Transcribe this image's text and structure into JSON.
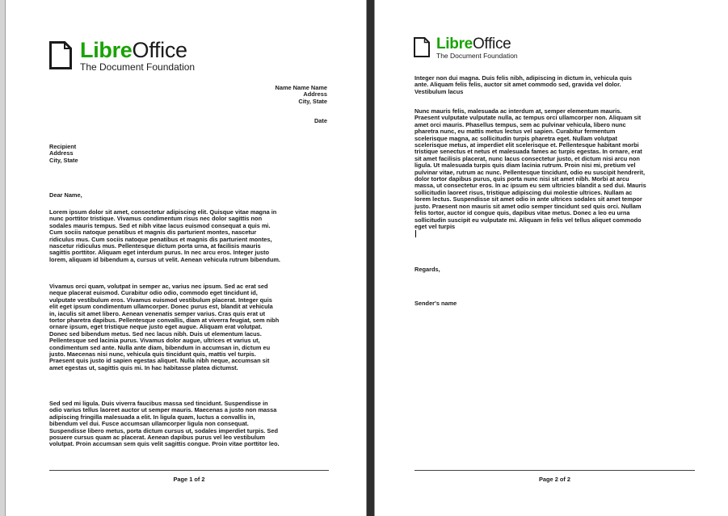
{
  "logo": {
    "libre": "Libre",
    "office": "Office",
    "tagline": "The Document Foundation"
  },
  "page1": {
    "sender": [
      "Name Name Name",
      "Address",
      "City, State"
    ],
    "date_label": "Date",
    "recipient": [
      "Recipient",
      "Address",
      "City, State"
    ],
    "greeting": "Dear Name,",
    "paragraph1": [
      "Lorem ipsum dolor sit amet, consectetur adipiscing elit. Quisque vitae magna in",
      "nunc porttitor tristique. Vivamus condimentum risus nec dolor sagittis non",
      "sodales mauris tempus. Sed et nibh vitae lacus euismod consequat a quis mi.",
      "Cum sociis natoque penatibus et magnis dis parturient montes, nascetur",
      "ridiculus mus. Cum sociis natoque penatibus et magnis dis parturient montes,",
      "nascetur ridiculus mus. Pellentesque dictum porta urna, at facilisis mauris",
      "sagittis porttitor. Aliquam eget interdum purus. In nec arcu eros. Integer justo",
      "lorem, aliquam id bibendum a, cursus ut velit. Aenean vehicula rutrum bibendum."
    ],
    "paragraph2": [
      "Vivamus orci quam, volutpat in semper ac, varius nec ipsum. Sed ac erat sed",
      "neque placerat euismod. Curabitur odio odio, commodo eget tincidunt id,",
      "vulputate vestibulum eros. Vivamus euismod vestibulum placerat. Integer quis",
      "elit eget ipsum condimentum ullamcorper. Donec purus est, blandit at vehicula",
      "in, iaculis sit amet libero. Aenean venenatis semper varius. Cras quis erat ut",
      "tortor pharetra dapibus. Pellentesque convallis, diam at viverra feugiat, sem nibh",
      "ornare ipsum, eget tristique neque justo eget augue. Aliquam erat volutpat.",
      "Donec sed bibendum metus. Sed nec lacus nibh. Duis ut elementum lacus.",
      "Pellentesque sed lacinia purus. Vivamus dolor augue, ultrices et varius ut,",
      "condimentum sed ante. Nulla ante diam, bibendum in accumsan in, dictum eu",
      "justo. Maecenas nisi nunc, vehicula quis tincidunt quis, mattis vel turpis.",
      "Praesent quis justo id sapien egestas aliquet. Nulla nibh neque, accumsan sit",
      "amet egestas ut, sagittis quis mi. In hac habitasse platea dictumst."
    ],
    "paragraph3": [
      "Sed sed mi ligula. Duis viverra faucibus massa sed tincidunt. Suspendisse in",
      "odio varius tellus laoreet auctor ut semper mauris. Maecenas a justo non massa",
      "adipiscing fringilla malesuada a elit. In ligula quam, luctus a convallis in,",
      "bibendum vel dui. Fusce accumsan ullamcorper ligula non consequat.",
      "Suspendisse libero metus, porta dictum cursus ut, sodales imperdiet turpis. Sed",
      "posuere cursus quam ac placerat. Aenean dapibus purus vel leo vestibulum",
      "volutpat. Proin accumsan sem quis velit sagittis congue. Proin vitae porttitor leo."
    ],
    "footer": "Page 1 of 2"
  },
  "page2": {
    "paragraph1": [
      "Integer non dui magna. Duis felis nibh, adipiscing in dictum in, vehicula quis",
      "ante. Aliquam felis felis, auctor sit amet commodo sed, gravida vel dolor.",
      "Vestibulum lacus"
    ],
    "paragraph2": [
      "Nunc mauris felis, malesuada ac interdum at, semper elementum mauris.",
      "Praesent vulputate vulputate nulla, ac tempus orci ullamcorper non. Aliquam sit",
      "amet orci mauris. Phasellus tempus, sem ac pulvinar vehicula, libero nunc",
      "pharetra nunc, eu mattis metus lectus vel sapien. Curabitur fermentum",
      "scelerisque magna, ac sollicitudin turpis pharetra eget. Nullam volutpat",
      "scelerisque metus, at imperdiet elit scelerisque et. Pellentesque habitant morbi",
      "tristique senectus et netus et malesuada fames ac turpis egestas. In ornare, erat",
      "sit amet facilisis placerat, nunc lacus consectetur justo, et dictum nisi arcu non",
      "ligula. Ut malesuada turpis quis diam lacinia rutrum. Proin nisi mi, pretium vel",
      "pulvinar vitae, rutrum ac nunc. Pellentesque tincidunt, odio eu suscipit hendrerit,",
      "dolor tortor dapibus purus, quis porta nunc nisi sit amet nibh. Morbi at arcu",
      "massa, ut consectetur eros. In ac ipsum eu sem ultricies blandit a sed dui. Mauris",
      "sollicitudin laoreet risus, tristique adipiscing dui molestie ultrices. Nullam ac",
      "lorem lectus. Suspendisse sit amet odio in ante ultrices sodales sit amet tempor",
      "justo. Praesent non mauris sit amet odio semper tincidunt sed quis orci. Nullam",
      "felis tortor, auctor id congue quis, dapibus vitae metus. Donec a leo eu urna",
      "sollicitudin suscipit eu vulputate mi. Aliquam in felis vel tellus aliquet commodo",
      "eget vel turpis"
    ],
    "closing": "Regards,",
    "signature": "Sender's name",
    "footer": "Page 2 of 2"
  }
}
